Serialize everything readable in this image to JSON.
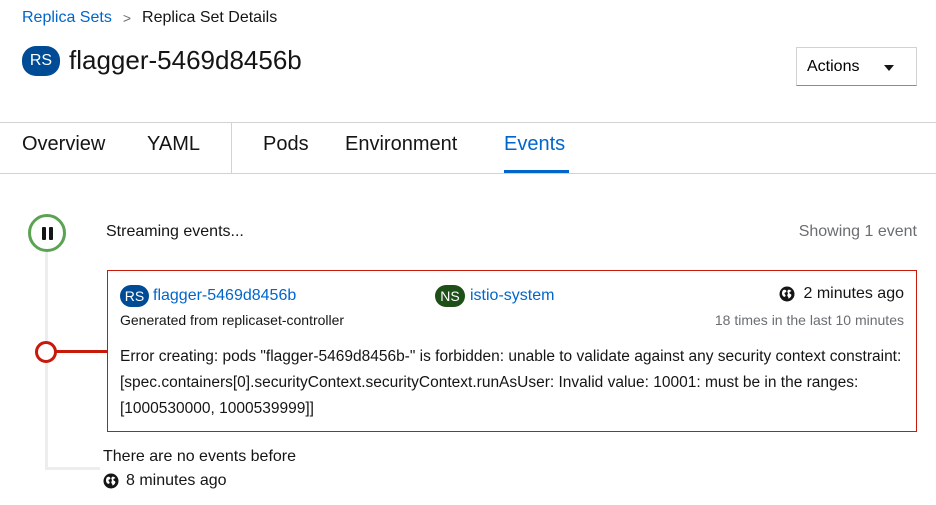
{
  "breadcrumb": {
    "parent": "Replica Sets",
    "separator": ">",
    "current": "Replica Set Details"
  },
  "header": {
    "badge": "RS",
    "title": "flagger-5469d8456b",
    "actions_label": "Actions"
  },
  "tabs": [
    {
      "label": "Overview",
      "active": false
    },
    {
      "label": "YAML",
      "active": false
    },
    {
      "label": "Pods",
      "active": false
    },
    {
      "label": "Environment",
      "active": false
    },
    {
      "label": "Events",
      "active": true
    }
  ],
  "events": {
    "status": "Streaming events...",
    "count_text": "Showing 1 event",
    "items": [
      {
        "resource_badge": "RS",
        "resource_name": "flagger-5469d8456b",
        "namespace_badge": "NS",
        "namespace": "istio-system",
        "time": "2 minutes ago",
        "source": "Generated from replicaset-controller",
        "repeat": "18 times in the last 10 minutes",
        "message": "Error creating: pods \"flagger-5469d8456b-\" is forbidden: unable to validate against any security context constraint: [spec.containers[0].securityContext.securityContext.runAsUser: Invalid value: 10001: must be in the ranges: [1000530000, 1000539999]]",
        "severity_color": "#c9190b"
      }
    ],
    "no_more_text": "There are no events before",
    "no_more_time": "8 minutes ago"
  },
  "colors": {
    "link": "#0066cc",
    "rs_badge": "#004b95",
    "ns_badge": "#1e4f18",
    "stream_active": "#5ba352",
    "error": "#c9190b"
  }
}
